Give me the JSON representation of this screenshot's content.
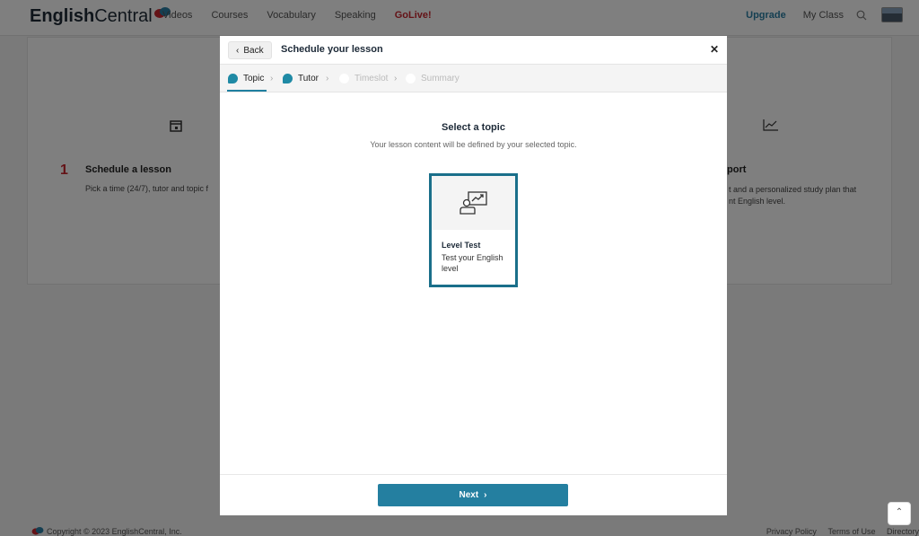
{
  "nav": {
    "logo_bold": "English",
    "logo_thin": "Central",
    "links": [
      "Videos",
      "Courses",
      "Vocabulary",
      "Speaking"
    ],
    "golive": "GoLive!",
    "upgrade": "Upgrade",
    "my_class": "My Class"
  },
  "background": {
    "step_number": "1",
    "schedule_heading": "Schedule a lesson",
    "schedule_text": "Pick a time (24/7), tutor and topic f",
    "report_heading": "port",
    "report_text_1": "t and a personalized study plan that",
    "report_text_2": "nt English level."
  },
  "footer": {
    "copyright": "Copyright © 2023 EnglishCentral, Inc.",
    "links": [
      "Privacy Policy",
      "Terms of Use",
      "Directory"
    ]
  },
  "modal": {
    "back_label": "Back",
    "title": "Schedule your lesson",
    "close_label": "✕",
    "steps": [
      {
        "label": "Topic",
        "state": "done"
      },
      {
        "label": "Tutor",
        "state": "done"
      },
      {
        "label": "Timeslot",
        "state": "pending"
      },
      {
        "label": "Summary",
        "state": "pending"
      }
    ],
    "heading": "Select a topic",
    "subheading": "Your lesson content will be defined by your selected topic.",
    "topic": {
      "name": "Level Test",
      "description": "Test your English level"
    },
    "next_label": "Next"
  },
  "colors": {
    "accent": "#247fa0",
    "brand_red": "#c8262f"
  }
}
